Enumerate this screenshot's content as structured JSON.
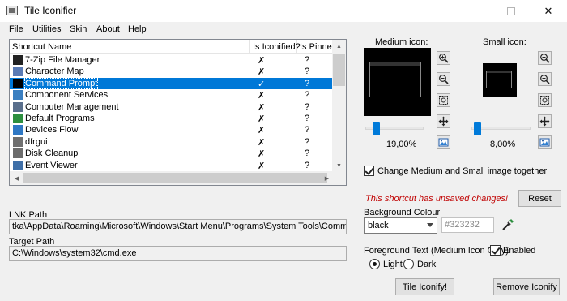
{
  "window": {
    "title": "Tile Iconifier"
  },
  "menu": [
    {
      "label": "File"
    },
    {
      "label": "Utilities"
    },
    {
      "label": "Skin"
    },
    {
      "label": "About"
    },
    {
      "label": "Help"
    }
  ],
  "list": {
    "columns": [
      "Shortcut Name",
      "Is Iconified?",
      "Is Pinned?"
    ],
    "rows": [
      {
        "name": "7-Zip File Manager",
        "iconified": "✗",
        "pinned": "?",
        "icon": "7zip-icon",
        "color": "#222222"
      },
      {
        "name": "Character Map",
        "iconified": "✗",
        "pinned": "?",
        "icon": "character-map-icon",
        "color": "#5a7bb5"
      },
      {
        "name": "Command Prompt",
        "iconified": "✓",
        "pinned": "?",
        "icon": "command-prompt-icon",
        "color": "#000000",
        "selected": true
      },
      {
        "name": "Component Services",
        "iconified": "✗",
        "pinned": "?",
        "icon": "component-services-icon",
        "color": "#3a7fc1"
      },
      {
        "name": "Computer Management",
        "iconified": "✗",
        "pinned": "?",
        "icon": "computer-management-icon",
        "color": "#5a6f8c"
      },
      {
        "name": "Default Programs",
        "iconified": "✗",
        "pinned": "?",
        "icon": "default-programs-icon",
        "color": "#2d8f3f"
      },
      {
        "name": "Devices Flow",
        "iconified": "✗",
        "pinned": "?",
        "icon": "devices-flow-icon",
        "color": "#2f78c4"
      },
      {
        "name": "dfrgui",
        "iconified": "✗",
        "pinned": "?",
        "icon": "dfrgui-icon",
        "color": "#6f6f6f"
      },
      {
        "name": "Disk Cleanup",
        "iconified": "✗",
        "pinned": "?",
        "icon": "disk-cleanup-icon",
        "color": "#6c6c6c"
      },
      {
        "name": "Event Viewer",
        "iconified": "✗",
        "pinned": "?",
        "icon": "event-viewer-icon",
        "color": "#3f6fa8"
      }
    ]
  },
  "lnk": {
    "label": "LNK Path",
    "value": "tka\\AppData\\Roaming\\Microsoft\\Windows\\Start Menu\\Programs\\System Tools\\Command Prompt.lnk"
  },
  "target": {
    "label": "Target Path",
    "value": "C:\\Windows\\system32\\cmd.exe"
  },
  "medium": {
    "label": "Medium icon:",
    "zoom": "19,00%",
    "slider_fraction": 0.15
  },
  "small": {
    "label": "Small icon:",
    "zoom": "8,00%",
    "slider_fraction": 0.05
  },
  "tool_icons": [
    "zoom-in-icon",
    "zoom-out-icon",
    "fit-icon",
    "move-icon",
    "image-icon"
  ],
  "change_together": {
    "label": "Change Medium and Small image together",
    "checked": true
  },
  "unsaved": {
    "text": "This shortcut has unsaved changes!"
  },
  "reset_button": "Reset",
  "background": {
    "label": "Background Colour",
    "selected": "black",
    "hex_placeholder": "#323232"
  },
  "foreground": {
    "label": "Foreground Text (Medium Icon Only)",
    "enabled_label": "Enabled",
    "enabled": true,
    "light_label": "Light",
    "dark_label": "Dark",
    "selected": "light"
  },
  "buttons": {
    "iconify": "Tile Iconify!",
    "remove": "Remove Iconify"
  },
  "colors": {
    "selection": "#0078d7",
    "warning": "#c00000",
    "slider": "#007ad9"
  }
}
